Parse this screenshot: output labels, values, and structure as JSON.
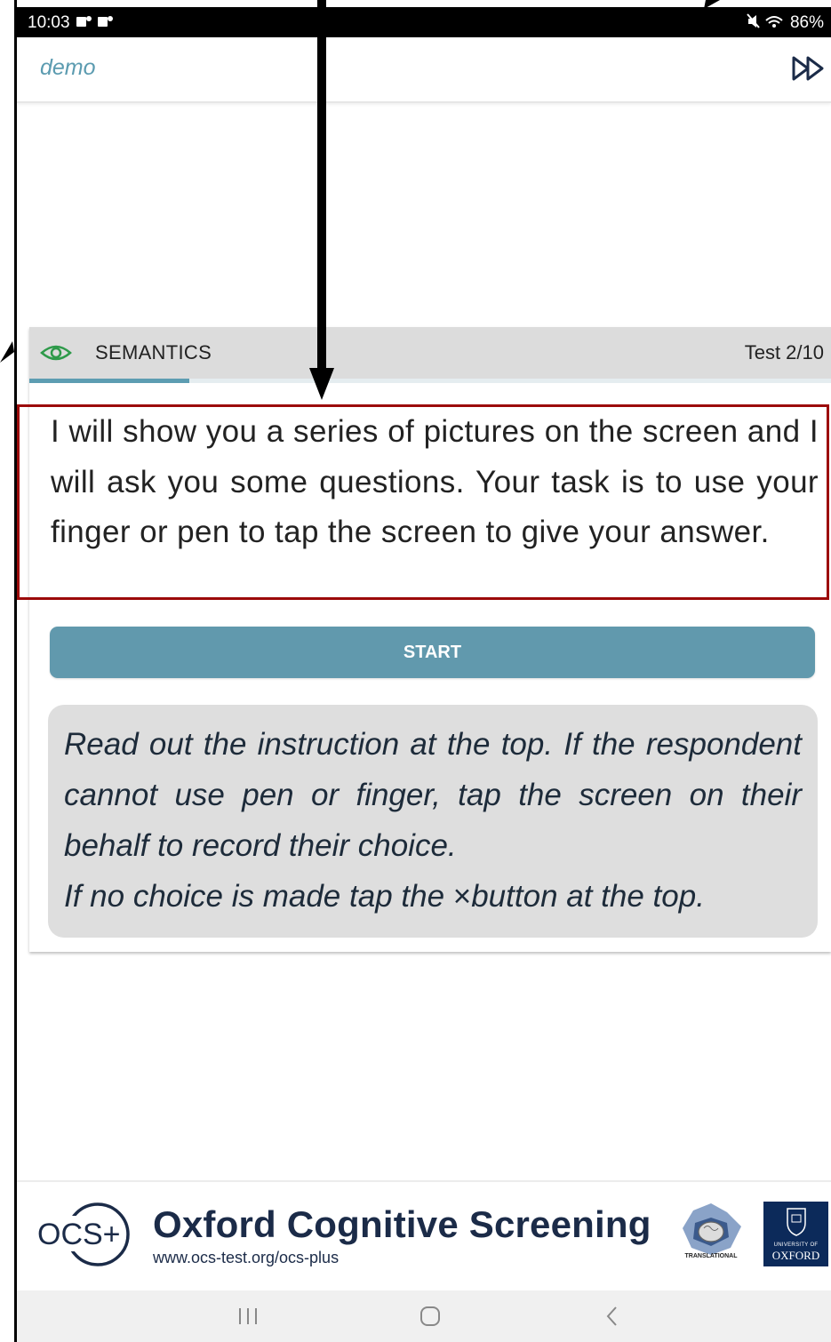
{
  "status_bar": {
    "time": "10:03",
    "notification_icons": "🗨🗨",
    "battery": "86%"
  },
  "app_bar": {
    "title": "demo",
    "skip_icon": "fast-forward-icon"
  },
  "card": {
    "section_title": "SEMANTICS",
    "test_counter": "Test 2/10",
    "progress_fraction": 0.2,
    "instruction": "I will show you a series of pictures on the screen and I will ask you some questions. Your task is to use your finger or pen to tap the screen to give your answer.",
    "start_label": "START",
    "note_main": "Read out the instruction at the top. If the respondent cannot use pen or finger, tap the screen on their behalf to record their choice.",
    "note_second_prefix": "If no choice is made tap the ",
    "note_times_symbol": "×",
    "note_second_suffix": "button at the top."
  },
  "footer": {
    "logo_text": "OCS+",
    "title": "Oxford Cognitive Screening",
    "url": "www.ocs-test.org/ocs-plus",
    "partner_label": "TRANSLATIONAL",
    "oxford_small": "UNIVERSITY OF",
    "oxford_name": "OXFORD"
  },
  "colors": {
    "accent": "#5d9db2",
    "highlight_border": "#9c0a0a",
    "footer_navy": "#1b2b48"
  }
}
